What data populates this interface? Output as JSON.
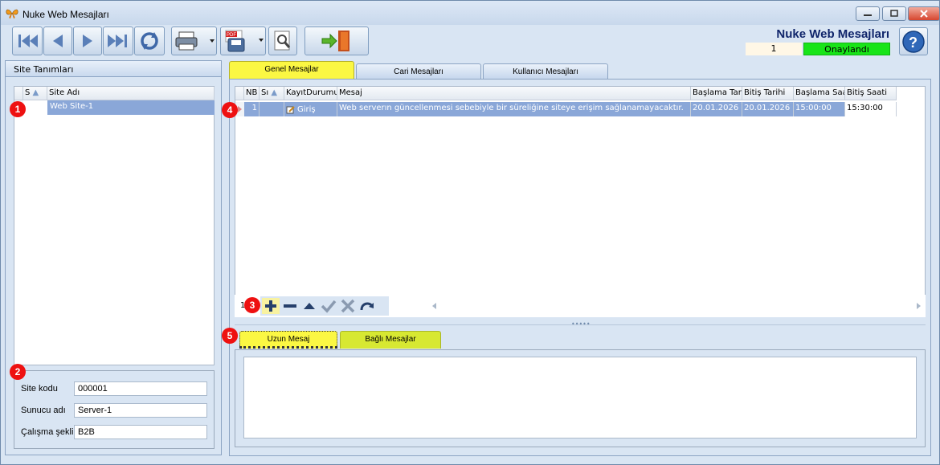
{
  "window": {
    "title": "Nuke Web Mesajları"
  },
  "header": {
    "title": "Nuke Web Mesajları",
    "record_no": "1",
    "status": "Onaylandı"
  },
  "toolbar": {
    "icons": [
      "first-record-icon",
      "prev-record-icon",
      "next-record-icon",
      "last-record-icon",
      "refresh-icon",
      "print-icon",
      "pdf-save-icon",
      "search-tool-icon",
      "exit-door-icon",
      "help-icon"
    ]
  },
  "left": {
    "header": "Site Tanımları",
    "grid": {
      "columns": [
        "S",
        "Site Adı"
      ],
      "rows": [
        {
          "s": "",
          "site_name": "Web Site-1"
        }
      ]
    },
    "fields": {
      "site_code_label": "Site kodu",
      "site_code_value": "000001",
      "server_label": "Sunucu adı",
      "server_value": "Server-1",
      "mode_label": "Çalışma şekli",
      "mode_value": "B2B"
    }
  },
  "tabs": [
    "Genel Mesajlar",
    "Cari Mesajları",
    "Kullanıcı Mesajları"
  ],
  "messages": {
    "columns": [
      "NB",
      "Sı",
      "KayıtDurumu",
      "Mesaj",
      "Başlama Tari",
      "Bitiş Tarihi",
      "Başlama Saa",
      "Bitiş Saati"
    ],
    "rows": [
      {
        "nb": "1",
        "si": "",
        "status": "Giriş",
        "message": "Web serverın güncellenmesi sebebiyle bir süreliğine siteye erişim sağlanamayacaktır.",
        "start_date": "20.01.2026",
        "end_date": "20.01.2026",
        "start_time": "15:00:00",
        "end_time": "15:30:00"
      }
    ],
    "nav_count": "1"
  },
  "bottom_tabs": [
    "Uzun Mesaj",
    "Bağlı Mesajlar"
  ],
  "badges": [
    "1",
    "2",
    "3",
    "4",
    "5"
  ],
  "colors": {
    "active_tab": "#fbf743",
    "status_green": "#18e418",
    "selected_row": "#8aa7d8",
    "badge": "#ee1111"
  }
}
